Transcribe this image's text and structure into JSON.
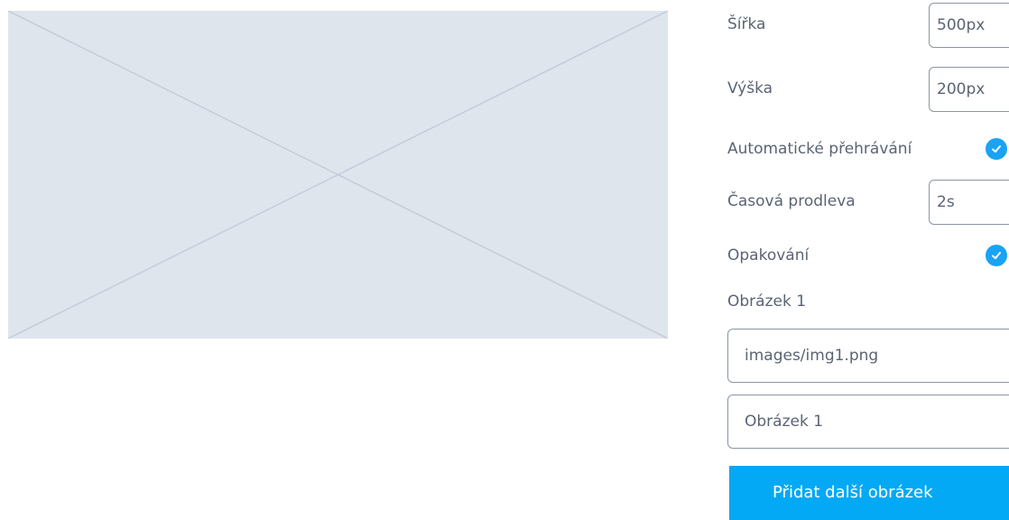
{
  "settings": {
    "width_label": "Šířka",
    "width_value": "500px",
    "height_label": "Výška",
    "height_value": "200px",
    "autoplay_label": "Automatické přehrávání",
    "autoplay_checked": true,
    "delay_label": "Časová prodleva",
    "delay_value": "2s",
    "loop_label": "Opakování",
    "loop_checked": true
  },
  "image1": {
    "section_label": "Obrázek 1",
    "path_value": "images/img1.png",
    "caption_placeholder": "Obrázek 1"
  },
  "add_button_label": "Přidat další obrázek",
  "colors": {
    "accent": "#03a9f4",
    "check": "#1aa3f5",
    "placeholder_bg": "#dfe5ed",
    "text": "#5a6473",
    "border": "#8a95a5"
  }
}
